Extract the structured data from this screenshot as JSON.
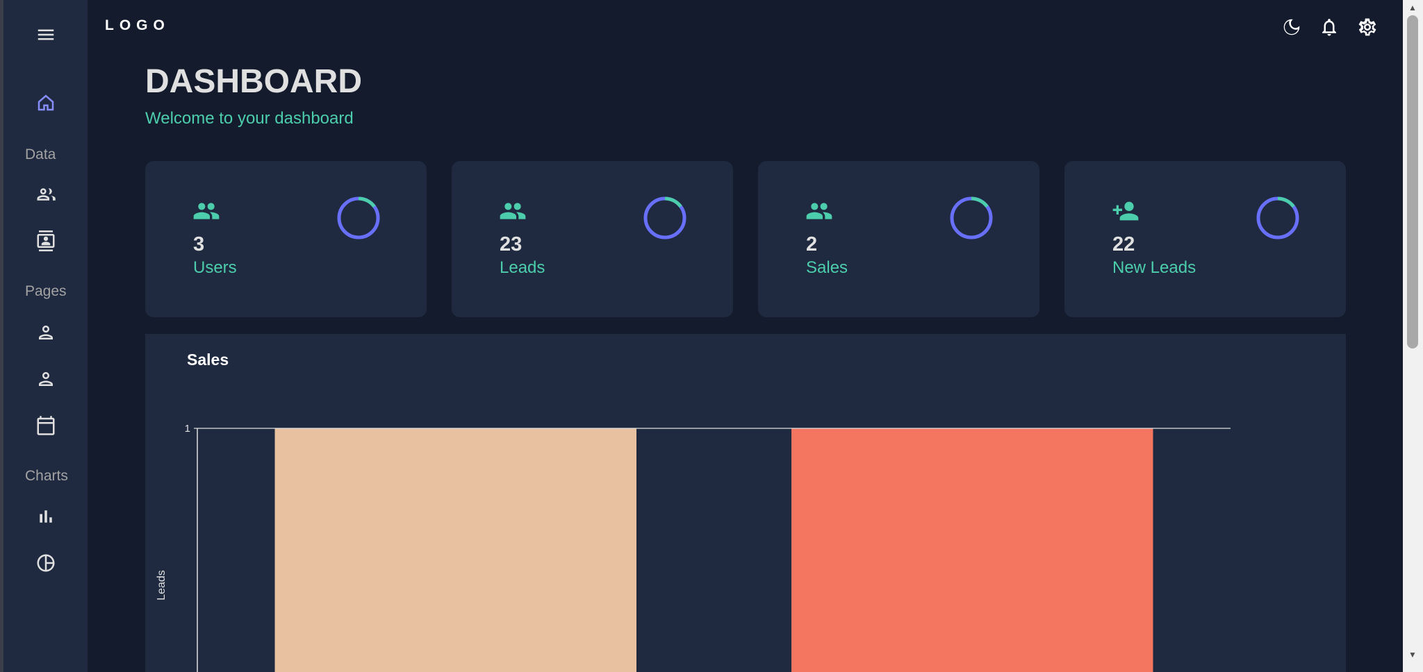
{
  "topbar": {
    "logo": "LOGO",
    "icons": [
      "dark-mode-icon",
      "notifications-icon",
      "settings-icon"
    ]
  },
  "sidebar": {
    "menu_icon": "menu-icon",
    "sections": {
      "data": "Data",
      "pages": "Pages",
      "charts": "Charts"
    },
    "items": [
      {
        "icon": "home-icon",
        "active": true
      },
      {
        "icon": "team-icon"
      },
      {
        "icon": "contacts-icon"
      },
      {
        "icon": "profile-icon"
      },
      {
        "icon": "profile-icon"
      },
      {
        "icon": "calendar-icon"
      },
      {
        "icon": "bar-chart-icon"
      },
      {
        "icon": "pie-chart-icon"
      }
    ]
  },
  "header": {
    "title": "DASHBOARD",
    "subtitle": "Welcome to your dashboard"
  },
  "stats": [
    {
      "value": "3",
      "label": "Users",
      "icon": "people-icon",
      "progress": 0.15
    },
    {
      "value": "23",
      "label": "Leads",
      "icon": "people-icon",
      "progress": 0.15
    },
    {
      "value": "2",
      "label": "Sales",
      "icon": "people-icon",
      "progress": 0.15
    },
    {
      "value": "22",
      "label": "New Leads",
      "icon": "person-add-icon",
      "progress": 0.15
    }
  ],
  "sales_panel": {
    "title": "Sales"
  },
  "chart_data": {
    "type": "bar",
    "ylabel": "Leads",
    "ylim": [
      0,
      1
    ],
    "yticks": [
      "1"
    ],
    "categories": [
      "",
      ""
    ],
    "values": [
      1,
      1
    ],
    "colors": [
      "#e8c1a0",
      "#f47560"
    ]
  },
  "colors": {
    "background": "#141b2d",
    "panel": "#1f2a40",
    "accent_green": "#4cceac",
    "accent_blue": "#6870fa",
    "active_icon": "#868dfb"
  }
}
